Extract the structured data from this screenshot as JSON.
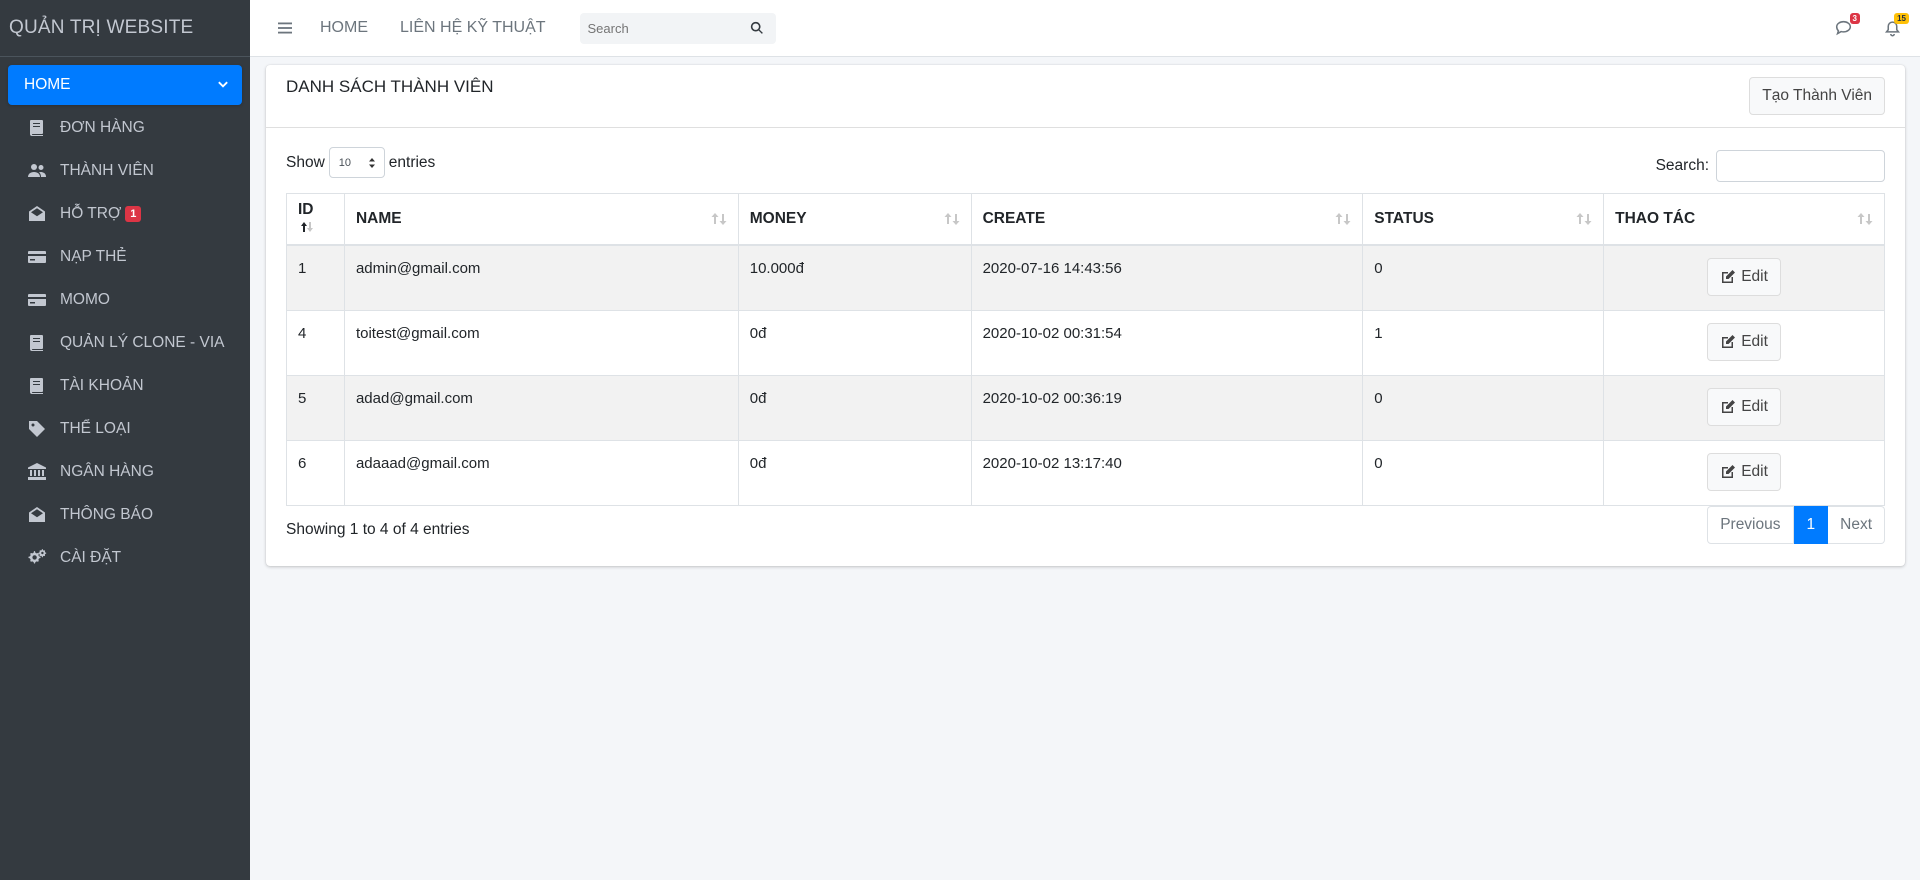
{
  "brand": "QUẢN TRỊ WEBSITE",
  "sidebar": {
    "items": [
      {
        "label": "HOME",
        "icon": "home",
        "active": true
      },
      {
        "label": "ĐƠN HÀNG",
        "icon": "book-icon"
      },
      {
        "label": "THÀNH VIÊN",
        "icon": "users-icon"
      },
      {
        "label": "HỖ TRỢ",
        "icon": "envelope-open-icon",
        "badge": "1"
      },
      {
        "label": "NẠP THẺ",
        "icon": "credit-card-icon"
      },
      {
        "label": "MOMO",
        "icon": "credit-card-icon"
      },
      {
        "label": "QUẢN LÝ CLONE - VIA",
        "icon": "book-icon"
      },
      {
        "label": "TÀI KHOẢN",
        "icon": "book-icon"
      },
      {
        "label": "THỂ LOẠI",
        "icon": "tag-icon"
      },
      {
        "label": "NGÂN HÀNG",
        "icon": "bank-icon"
      },
      {
        "label": "THÔNG BÁO",
        "icon": "envelope-open-icon"
      },
      {
        "label": "CÀI ĐẶT",
        "icon": "cogs-icon"
      }
    ]
  },
  "topbar": {
    "links": [
      "HOME",
      "LIÊN HỆ KỸ THUẬT"
    ],
    "search_placeholder": "Search",
    "messages_badge": "3",
    "notifications_badge": "15"
  },
  "card": {
    "title": "DANH SÁCH THÀNH VIÊN",
    "create_button": "Tạo Thành Viên",
    "show_label": "Show",
    "page_size": "10",
    "entries_label": "entries",
    "search_label": "Search:"
  },
  "table": {
    "columns": [
      "ID",
      "NAME",
      "MONEY",
      "CREATE",
      "STATUS",
      "THAO TÁC"
    ],
    "rows": [
      {
        "id": "1",
        "name": "admin@gmail.com",
        "money": "10.000đ",
        "create": "2020-07-16 14:43:56",
        "status": "0",
        "action": "Edit"
      },
      {
        "id": "4",
        "name": "toitest@gmail.com",
        "money": "0đ",
        "create": "2020-10-02 00:31:54",
        "status": "1",
        "action": "Edit"
      },
      {
        "id": "5",
        "name": "adad@gmail.com",
        "money": "0đ",
        "create": "2020-10-02 00:36:19",
        "status": "0",
        "action": "Edit"
      },
      {
        "id": "6",
        "name": "adaaad@gmail.com",
        "money": "0đ",
        "create": "2020-10-02 13:17:40",
        "status": "0",
        "action": "Edit"
      }
    ]
  },
  "footer": {
    "info": "Showing 1 to 4 of 4 entries",
    "previous": "Previous",
    "current_page": "1",
    "next": "Next"
  },
  "colors": {
    "sidebar_bg": "#343a40",
    "accent": "#007bff",
    "badge_danger": "#dc3545",
    "badge_warning": "#ffc107"
  }
}
